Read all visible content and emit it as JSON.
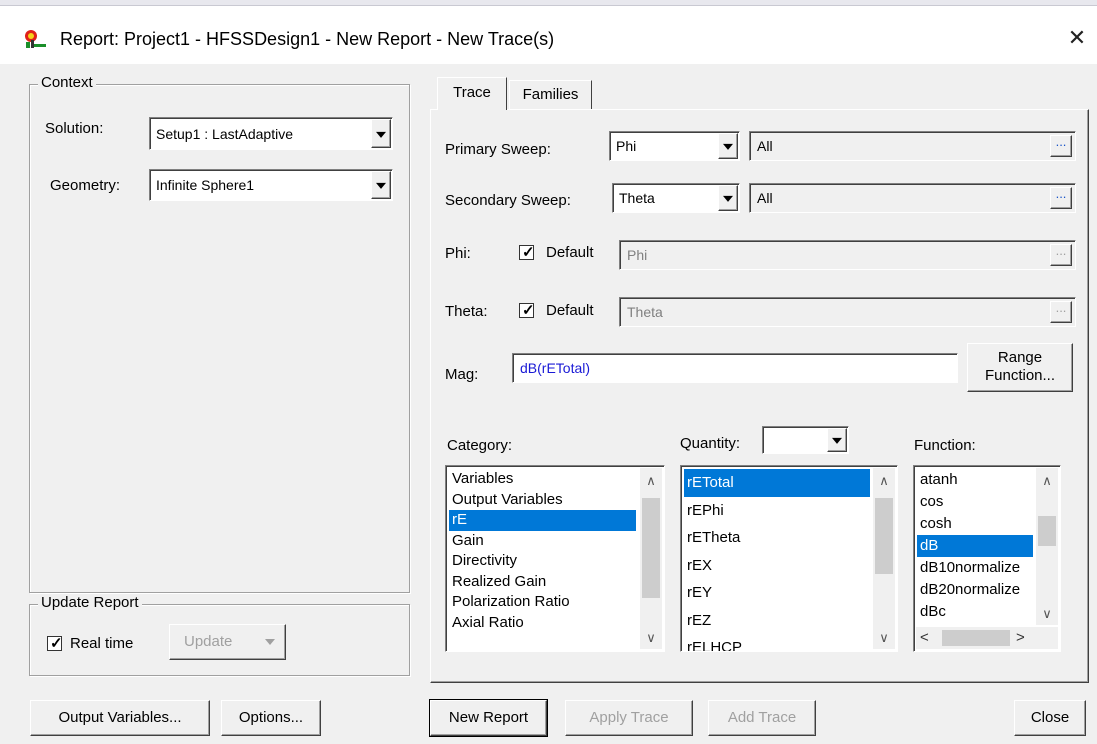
{
  "window": {
    "title": "Report: Project1 - HFSSDesign1 - New Report - New Trace(s)",
    "close_glyph": "✕",
    "icon": "hfss-report-icon"
  },
  "context": {
    "group_label": "Context",
    "solution_label": "Solution:",
    "solution_value": "Setup1 : LastAdaptive",
    "geometry_label": "Geometry:",
    "geometry_value": "Infinite Sphere1"
  },
  "update_report": {
    "group_label": "Update Report",
    "realtime_label": "Real time",
    "realtime_checked": true,
    "update_label": "Update"
  },
  "tabs": [
    {
      "label": "Trace",
      "active": true
    },
    {
      "label": "Families",
      "active": false
    }
  ],
  "trace": {
    "primary_sweep_label": "Primary Sweep:",
    "primary_sweep_value": "Phi",
    "primary_sweep_range": "All",
    "secondary_sweep_label": "Secondary Sweep:",
    "secondary_sweep_value": "Theta",
    "secondary_sweep_range": "All",
    "phi_label": "Phi:",
    "phi_default_label": "Default",
    "phi_default_checked": true,
    "phi_value": "Phi",
    "theta_label": "Theta:",
    "theta_default_label": "Default",
    "theta_default_checked": true,
    "theta_value": "Theta",
    "mag_label": "Mag:",
    "mag_value": "dB(rETotal)",
    "range_function_line1": "Range",
    "range_function_line2": "Function...",
    "ellipsis": "...",
    "category_label": "Category:",
    "quantity_label": "Quantity:",
    "quantity_value": "",
    "function_label": "Function:",
    "categories": [
      "Variables",
      "Output Variables",
      "rE",
      "Gain",
      "Directivity",
      "Realized Gain",
      "Polarization Ratio",
      "Axial Ratio"
    ],
    "category_selected": "rE",
    "quantities": [
      "rETotal",
      "rEPhi",
      "rETheta",
      "rEX",
      "rEY",
      "rEZ",
      "rELHCP"
    ],
    "quantity_selected": "rETotal",
    "functions": [
      "atanh",
      "cos",
      "cosh",
      "dB",
      "dB10normalize",
      "dB20normalize",
      "dBc"
    ],
    "function_selected": "dB"
  },
  "buttons": {
    "output_variables": "Output Variables...",
    "options": "Options...",
    "new_report": "New Report",
    "apply_trace": "Apply Trace",
    "add_trace": "Add Trace",
    "close": "Close"
  },
  "colors": {
    "selection": "#0078d7",
    "link_blue": "#1a1ad6"
  }
}
